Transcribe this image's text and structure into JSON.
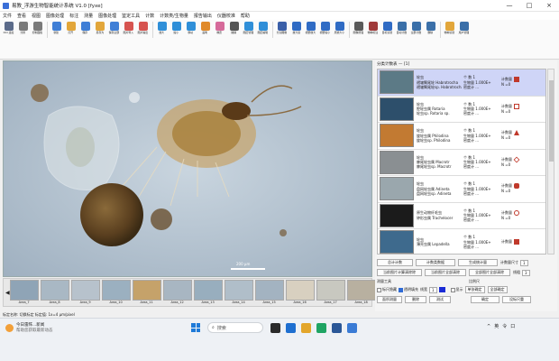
{
  "window": {
    "title": "易教_浮游生物智能统计系统 V1.0 [fyxe]",
    "controls": [
      "—",
      "□",
      "×"
    ]
  },
  "menu": [
    "文件",
    "查看",
    "视图",
    "图像处理",
    "标注",
    "测量",
    "图像处理",
    "鉴定工具",
    "计数",
    "计数类/生物量",
    "报告输出",
    "仪器校准",
    "帮助"
  ],
  "toolbar": [
    {
      "label": "DCI 连接",
      "icon": "microscope-icon",
      "color": "#5b6b8a"
    },
    {
      "label": "分辨",
      "icon": "camera-icon",
      "color": "#7a7a7a"
    },
    {
      "label": "控制面板",
      "icon": "panel-icon",
      "color": "#7a7a7a"
    },
    {
      "label": "新建",
      "icon": "new-file-icon",
      "color": "#3f7fd6"
    },
    {
      "label": "打开",
      "icon": "folder-icon",
      "color": "#e2a63a"
    },
    {
      "label": "保存",
      "icon": "save-icon",
      "color": "#3f7fd6"
    },
    {
      "label": "另存为",
      "icon": "folder-icon",
      "color": "#e2a63a"
    },
    {
      "label": "保存全部",
      "icon": "save-all-icon",
      "color": "#3f7fd6"
    },
    {
      "label": "图片导入",
      "icon": "image-import-icon",
      "color": "#d6534f"
    },
    {
      "label": "图片输出",
      "icon": "image-export-icon",
      "color": "#d6534f"
    },
    {
      "label": "放大",
      "icon": "zoom-in-icon",
      "color": "#2f8fd8"
    },
    {
      "label": "缩小",
      "icon": "zoom-out-icon",
      "color": "#2f8fd8"
    },
    {
      "label": "移动",
      "icon": "move-icon",
      "color": "#2f8fd8"
    },
    {
      "label": "画笔",
      "icon": "pen-icon",
      "color": "#e08a2a"
    },
    {
      "label": "橡皮",
      "icon": "eraser-icon",
      "color": "#d66a9a"
    },
    {
      "label": "撤销",
      "icon": "undo-icon",
      "color": "#555555"
    },
    {
      "label": "图层管理",
      "icon": "layers-icon",
      "color": "#2f8fd8"
    },
    {
      "label": "图层编辑",
      "icon": "layer-edit-icon",
      "color": "#2f8fd8"
    },
    {
      "label": "分割图像",
      "icon": "grid-icon",
      "color": "#3a5fa8"
    },
    {
      "label": "放大镜",
      "icon": "magnifier-icon",
      "color": "#2f6bc4"
    },
    {
      "label": "视野放大",
      "icon": "magnifier-plus-icon",
      "color": "#2f6bc4"
    },
    {
      "label": "视野缩小",
      "icon": "magnifier-minus-icon",
      "color": "#2f6bc4"
    },
    {
      "label": "原始大小",
      "icon": "magnifier-1to1-icon",
      "color": "#2f6bc4"
    },
    {
      "label": "图像增强",
      "icon": "enhance-icon",
      "color": "#5a5a5a"
    },
    {
      "label": "物种标注",
      "icon": "species-mark-icon",
      "color": "#a03a3a"
    },
    {
      "label": "目标识别",
      "icon": "target-icon",
      "color": "#2f6bc4"
    },
    {
      "label": "自动计数",
      "icon": "auto-count-icon",
      "color": "#3a6fa8"
    },
    {
      "label": "全部计数",
      "icon": "count-all-icon",
      "color": "#3a6fa8"
    },
    {
      "label": "删除",
      "icon": "delete-icon",
      "color": "#3a6fa8"
    },
    {
      "label": "物种识别",
      "icon": "species-id-icon",
      "color": "#e2a63a"
    },
    {
      "label": "用户管理",
      "icon": "user-icon",
      "color": "#3a6fa8"
    }
  ],
  "viewer": {
    "scale_label": "200 μm"
  },
  "thumbnails": [
    "Area_7",
    "Area_8",
    "Area_9",
    "Area_10",
    "Area_11",
    "Area_12",
    "Area_13",
    "Area_14",
    "Area_15",
    "Area_16",
    "Area_17",
    "Area_18"
  ],
  "species_panel": {
    "header": "分类计数表 — [1]",
    "items": [
      {
        "cn": "轮虫",
        "genus": "褶皱臂尾轮 Habrotrocha",
        "latin": "褶皱臂尾轮sp. Habrotrocha",
        "count_label": "个 数 1",
        "bio": "生物量",
        "bio_val": "1.000E+",
        "density": "密度计 ...",
        "mark_label": "计数量",
        "n": "N =0",
        "mark_color": "#c0392b",
        "mark_shape": "square",
        "selected": true,
        "tone": "#5c7a86"
      },
      {
        "cn": "轮虫",
        "genus": "腔轮虫属 Rotaria",
        "latin": "轮虫sp. Rotaria sp.",
        "count_label": "个 数 1",
        "bio": "生物量",
        "bio_val": "1.000E+",
        "density": "密度计 ...",
        "mark_label": "计数量",
        "n": "N =0",
        "mark_color": "#c0392b",
        "mark_shape": "square-outline",
        "selected": false,
        "tone": "#2d4f6b"
      },
      {
        "cn": "轮虫",
        "genus": "旋轮虫属 Philodina",
        "latin": "旋轮虫sp. Philodina",
        "count_label": "个 数 1",
        "bio": "生物量",
        "bio_val": "1.000E+",
        "density": "密度计 ...",
        "mark_label": "计数量",
        "n": "N =0",
        "mark_color": "#c0392b",
        "mark_shape": "triangle",
        "selected": false,
        "tone": "#c27a32"
      },
      {
        "cn": "轮虫",
        "genus": "棘尾轮虫属 Macrotr",
        "latin": "棘尾轮虫sp. Macrotr",
        "count_label": "个 数 1",
        "bio": "生物量",
        "bio_val": "1.000E+",
        "density": "密度计 ...",
        "mark_label": "计数量",
        "n": "N =0",
        "mark_color": "#c0392b",
        "mark_shape": "diamond",
        "selected": false,
        "tone": "#8a8f92"
      },
      {
        "cn": "轮虫",
        "genus": "盘网轮虫属 Adineta",
        "latin": "盘网轮虫sp. Adineta",
        "count_label": "个 数 1",
        "bio": "生物量",
        "bio_val": "1.000E+",
        "density": "密度计 ...",
        "mark_label": "计数量",
        "n": "N =0",
        "mark_color": "#c0392b",
        "mark_shape": "gear",
        "selected": false,
        "tone": "#9aa7ad"
      },
      {
        "cn": "原生动物纤毛虫",
        "genus": "钟形虫属 Trachelocer",
        "latin": "",
        "count_label": "个 数 1",
        "bio": "生物量",
        "bio_val": "1.000E+",
        "density": "密度计 ...",
        "mark_label": "计数量",
        "n": "N =0",
        "mark_color": "#c0392b",
        "mark_shape": "circle",
        "selected": false,
        "tone": "#1b1b1b"
      },
      {
        "cn": "轮虫",
        "genus": "薄壳虫属 Lepadella",
        "latin": "",
        "count_label": "个 数 1",
        "bio": "生物量",
        "bio_val": "1.000E+",
        "density": "密度计 ...",
        "mark_label": "计数量",
        "n": "",
        "mark_color": "#c0392b",
        "mark_shape": "square",
        "selected": false,
        "tone": "#3e6a8d"
      }
    ]
  },
  "controls": {
    "row1": [
      "总计计数",
      "计数类数据",
      "生成统计量"
    ],
    "scale_label": "计数量尺寸",
    "scale_value": "1",
    "row2": [
      "当前图片计算清除除",
      "当前图片全部清除",
      "全部图片全部清除"
    ],
    "line_label": "线粗",
    "line_value": "3",
    "measure_tools_label": "测量工具",
    "compare_label": "比例尺",
    "row3_checks": [
      "标尺隐藏",
      "透明填充"
    ],
    "line_width_label": "线宽",
    "line_width_value": "1",
    "show_label": "显示",
    "row3_buttons": [
      "单张确定",
      "全部确定"
    ],
    "row4": [
      "面积测量",
      "删除",
      "测试",
      "确定",
      "设标尺重"
    ]
  },
  "status": {
    "text": "标定名称: 切换标定   标定值: 1x=4 μm/pixel"
  },
  "taskbar": {
    "weather_title": "今日雷阵...新闻",
    "weather_sub": "帮助您获取最新动态",
    "search_placeholder": "搜索",
    "tray": [
      "^",
      "英",
      "令",
      "口"
    ],
    "time": "",
    "date": ""
  }
}
